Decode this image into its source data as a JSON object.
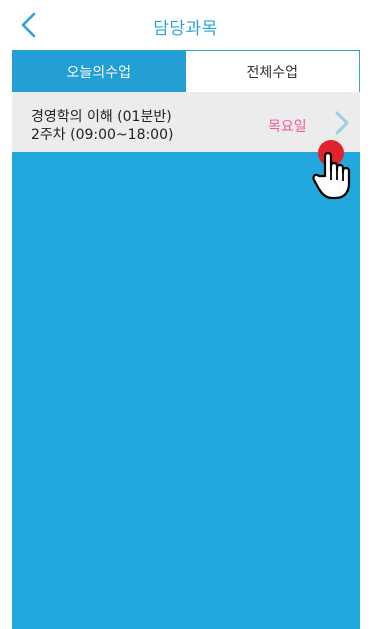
{
  "header": {
    "title": "담당과목",
    "back_icon": "chevron-left-icon"
  },
  "tabs": [
    {
      "label": "오늘의수업",
      "active": true
    },
    {
      "label": "전체수업",
      "active": false
    }
  ],
  "courses": [
    {
      "name": "경영학의 이해 (01분반)",
      "schedule": "2주차 (09:00~18:00)",
      "day": "목요일",
      "arrow_icon": "chevron-right-icon"
    }
  ],
  "overlay": {
    "touch_indicator_icon": "touch-dot-icon",
    "pointer_icon": "hand-pointer-icon"
  },
  "colors": {
    "accent": "#2aa3d6",
    "panel_bg": "#22a8dc",
    "row_bg": "#ececec",
    "day_text": "#f0579c",
    "touch_dot": "#e0222c"
  }
}
